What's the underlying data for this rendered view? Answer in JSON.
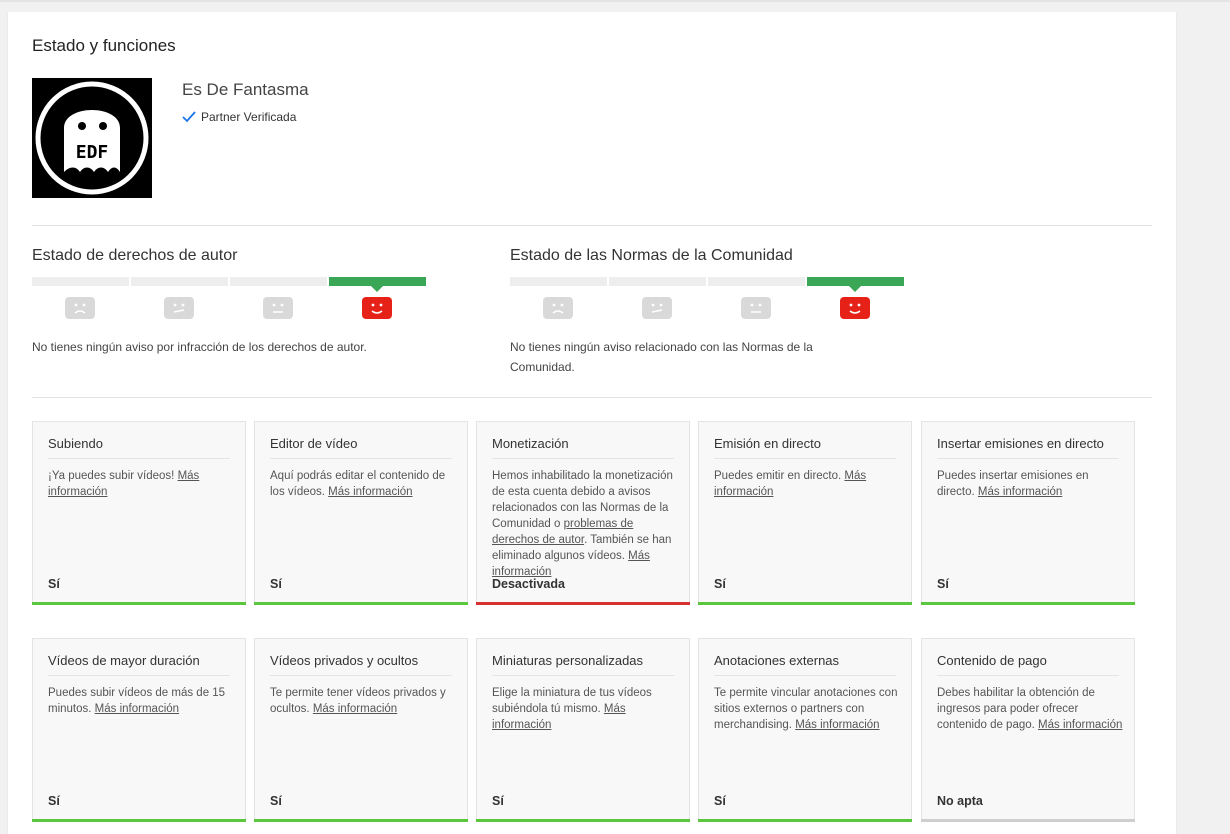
{
  "page": {
    "title": "Estado y funciones"
  },
  "channel": {
    "name": "Es De Fantasma",
    "partner_label": "Partner Verificada",
    "avatar_text": "EDF"
  },
  "copyright": {
    "title": "Estado de derechos de autor",
    "text": "No tienes ningún aviso por infracción de los derechos de autor.",
    "active_index": 3
  },
  "community": {
    "title": "Estado de las Normas de la Comunidad",
    "text": "No tienes ningún aviso relacionado con las Normas de la Comunidad.",
    "active_index": 3
  },
  "colors": {
    "ok": "#5ac73e",
    "disabled": "#d73233",
    "not_eligible": "#cfcfcf",
    "meter_active": "#3aa757",
    "face_active": "#e62117"
  },
  "features": [
    {
      "title": "Subiendo",
      "desc": "¡Ya puedes subir vídeos! ",
      "links": [
        "Más información"
      ],
      "status": "Sí",
      "state": "ok"
    },
    {
      "title": "Editor de vídeo",
      "desc": "Aquí podrás editar el contenido de los vídeos. ",
      "links": [
        "Más información"
      ],
      "status": "Sí",
      "state": "ok"
    },
    {
      "title": "Monetización",
      "desc": "Hemos inhabilitado la monetización de esta cuenta debido a avisos relacionados con las Normas de la Comunidad o ",
      "links": [
        "problemas de derechos de autor"
      ],
      "desc2": ". También se han eliminado algunos vídeos. ",
      "links2": [
        "Más información"
      ],
      "status": "Desactivada",
      "state": "disabled"
    },
    {
      "title": "Emisión en directo",
      "desc": "Puedes emitir en directo. ",
      "links": [
        "Más información"
      ],
      "status": "Sí",
      "state": "ok"
    },
    {
      "title": "Insertar emisiones en directo",
      "desc": "Puedes insertar emisiones en directo. ",
      "links": [
        "Más información"
      ],
      "status": "Sí",
      "state": "ok"
    },
    {
      "title": "Vídeos de mayor duración",
      "desc": "Puedes subir vídeos de más de 15 minutos. ",
      "links": [
        "Más información"
      ],
      "status": "Sí",
      "state": "ok"
    },
    {
      "title": "Vídeos privados y ocultos",
      "desc": "Te permite tener vídeos privados y ocultos. ",
      "links": [
        "Más información"
      ],
      "status": "Sí",
      "state": "ok"
    },
    {
      "title": "Miniaturas personalizadas",
      "desc": "Elige la miniatura de tus vídeos subiéndola tú mismo. ",
      "links": [
        "Más información"
      ],
      "status": "Sí",
      "state": "ok"
    },
    {
      "title": "Anotaciones externas",
      "desc": "Te permite vincular anotaciones con sitios externos o partners con merchandising. ",
      "links": [
        "Más información"
      ],
      "status": "Sí",
      "state": "ok"
    },
    {
      "title": "Contenido de pago",
      "desc": "Debes habilitar la obtención de ingresos para poder ofrecer contenido de pago. ",
      "links": [
        "Más información"
      ],
      "status": "No apta",
      "state": "not_eligible"
    }
  ]
}
